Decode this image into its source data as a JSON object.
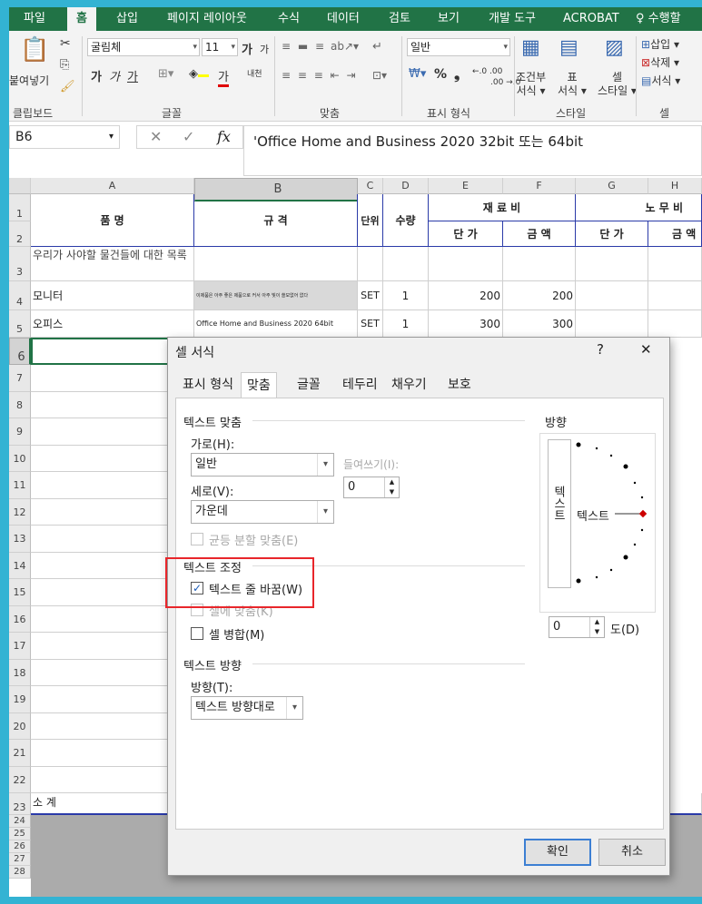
{
  "ribbon_tabs": [
    "파일",
    "홈",
    "삽입",
    "페이지 레이아웃",
    "수식",
    "데이터",
    "검토",
    "보기",
    "개발 도구",
    "ACROBAT",
    "수행할"
  ],
  "ribbon": {
    "paste_label": "붙여넣기",
    "font_name": "굴림체",
    "font_size": "11",
    "grow_font": "가 ᵃ",
    "shrink_font": "가 ᵃ",
    "bold": "가",
    "italic": "가",
    "underline": "가",
    "font_color_letter": "가",
    "phonetic": "내천",
    "number_format": "일반",
    "percent": "%",
    "comma": "❟",
    "inc_decimal": "←.0 .00",
    "dec_decimal": ".00 →.0",
    "cond_format": [
      "조건부",
      "서식 ▾"
    ],
    "table_format": [
      "표",
      "서식 ▾"
    ],
    "cell_style": [
      "셀",
      "스타일 ▾"
    ],
    "insert": "삽입 ▾",
    "delete": "삭제 ▾",
    "format": "서식 ▾",
    "groups": [
      "클립보드",
      "글꼴",
      "맞춤",
      "표시 형식",
      "스타일",
      "셀"
    ]
  },
  "formula_bar": {
    "name_box": "B6",
    "formula": "'Office Home and Business 2020 32bit 또는 64bit",
    "fx": "fx"
  },
  "grid": {
    "columns": [
      "A",
      "B",
      "C",
      "D",
      "E",
      "F",
      "G",
      "H"
    ],
    "rows": [
      "1",
      "2",
      "3",
      "4",
      "5",
      "6",
      "7",
      "8",
      "9",
      "10",
      "11",
      "12",
      "13",
      "14",
      "15",
      "16",
      "17",
      "18",
      "19",
      "20",
      "21",
      "22",
      "23",
      "24",
      "25",
      "26",
      "27",
      "28"
    ],
    "header": {
      "item": "품  명",
      "spec": "규  격",
      "unit": "단위",
      "qty": "수량",
      "material": "재  료  비",
      "labor": "노  무  비",
      "unit_price": "단  가",
      "amount": "금  액",
      "unit_price2": "단  가",
      "amount2": "금  액"
    },
    "row3_a": "우리가 사야할 물건들에 대한 목록",
    "row4": {
      "a": "모니터",
      "b": "이제품은 아주 좋은 제품으로 커서 아주 빛이 쓸모없어 없다",
      "c": "SET",
      "d": "1",
      "e": "200",
      "f": "200"
    },
    "row5": {
      "a": "오피스",
      "b": "Office Home and Business 2020 64bit",
      "c": "SET",
      "d": "1",
      "e": "300",
      "f": "300"
    },
    "row23_a": "소     계"
  },
  "dialog": {
    "title": "셀 서식",
    "help": "?",
    "close": "✕",
    "tabs": [
      "표시 형식",
      "맞춤",
      "글꼴",
      "테두리",
      "채우기",
      "보호"
    ],
    "active_tab": "맞춤",
    "text_align_section": "텍스트 맞춤",
    "horizontal_label": "가로(H):",
    "horizontal_value": "일반",
    "indent_label": "들여쓰기(I):",
    "indent_value": "0",
    "vertical_label": "세로(V):",
    "vertical_value": "가운데",
    "distributed_label": "균등 분할 맞춤(E)",
    "text_control_section": "텍스트 조정",
    "wrap_text_label": "텍스트 줄 바꿈(W)",
    "wrap_text_checked": true,
    "shrink_label": "셀에 맞춤(K)",
    "merge_label": "셀 병합(M)",
    "direction_section": "텍스트 방향",
    "direction_label": "방향(T):",
    "direction_value": "텍스트 방향대로",
    "orientation_section": "방향",
    "orientation_vertical_text": "텍스트",
    "orientation_text": "텍스트",
    "degree_value": "0",
    "degree_label": "도(D)",
    "ok": "확인",
    "cancel": "취소"
  },
  "colors": {
    "excel_green": "#217346",
    "highlight_red": "#e8262b",
    "frame_bg": "#33b3d3"
  }
}
